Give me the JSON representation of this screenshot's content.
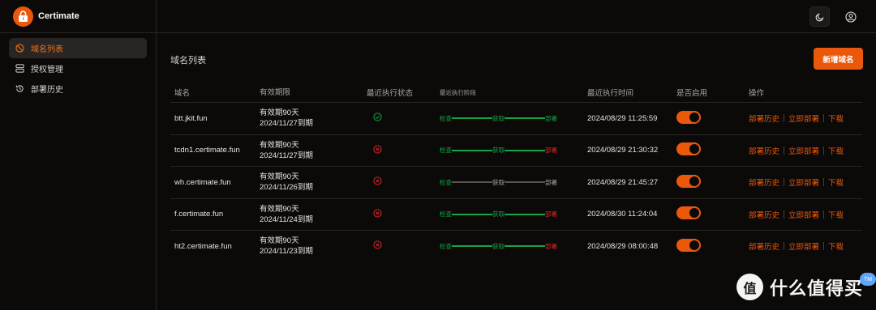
{
  "app": {
    "title": "Certimate"
  },
  "sidebar": {
    "items": [
      {
        "label": "域名列表",
        "icon": "globe-ban-icon",
        "active": true
      },
      {
        "label": "授权管理",
        "icon": "server-icon",
        "active": false
      },
      {
        "label": "部署历史",
        "icon": "history-icon",
        "active": false
      }
    ]
  },
  "topbar": {
    "theme_icon": "moon-icon",
    "user_icon": "user-circle-icon"
  },
  "main": {
    "title": "域名列表",
    "add_button": "新增域名",
    "columns": [
      "域名",
      "有效期限",
      "最近执行状态",
      "最近执行阶段",
      "最近执行时间",
      "是否启用",
      "操作"
    ],
    "stage_labels": [
      "检查",
      "获取",
      "部署"
    ],
    "op_labels": [
      "部署历史",
      "立即部署",
      "下载"
    ],
    "rows": [
      {
        "domain": "btt.jkit.fun",
        "valid": "有效期90天",
        "expire": "2024/11/27到期",
        "status": "success",
        "stages": [
          "ok",
          "ok",
          "ok"
        ],
        "time": "2024/08/29 11:25:59",
        "enabled": true
      },
      {
        "domain": "tcdn1.certimate.fun",
        "valid": "有效期90天",
        "expire": "2024/11/27到期",
        "status": "fail",
        "stages": [
          "ok",
          "ok",
          "fail"
        ],
        "time": "2024/08/29 21:30:32",
        "enabled": true
      },
      {
        "domain": "wh.certimate.fun",
        "valid": "有效期90天",
        "expire": "2024/11/26到期",
        "status": "fail",
        "stages": [
          "ok",
          "pending",
          "pending"
        ],
        "time": "2024/08/29 21:45:27",
        "enabled": true
      },
      {
        "domain": "f.certimate.fun",
        "valid": "有效期90天",
        "expire": "2024/11/24到期",
        "status": "fail",
        "stages": [
          "ok",
          "ok",
          "fail"
        ],
        "time": "2024/08/30 11:24:04",
        "enabled": true
      },
      {
        "domain": "ht2.certimate.fun",
        "valid": "有效期90天",
        "expire": "2024/11/23到期",
        "status": "fail",
        "stages": [
          "ok",
          "ok",
          "fail"
        ],
        "time": "2024/08/29 08:00:48",
        "enabled": true
      }
    ]
  },
  "watermark": {
    "glyph": "值",
    "text": "什么值得买",
    "badge": "TM"
  },
  "colors": {
    "accent": "#ea580c",
    "success": "#16a34a",
    "fail": "#dc2626",
    "pending": "#57534e"
  }
}
